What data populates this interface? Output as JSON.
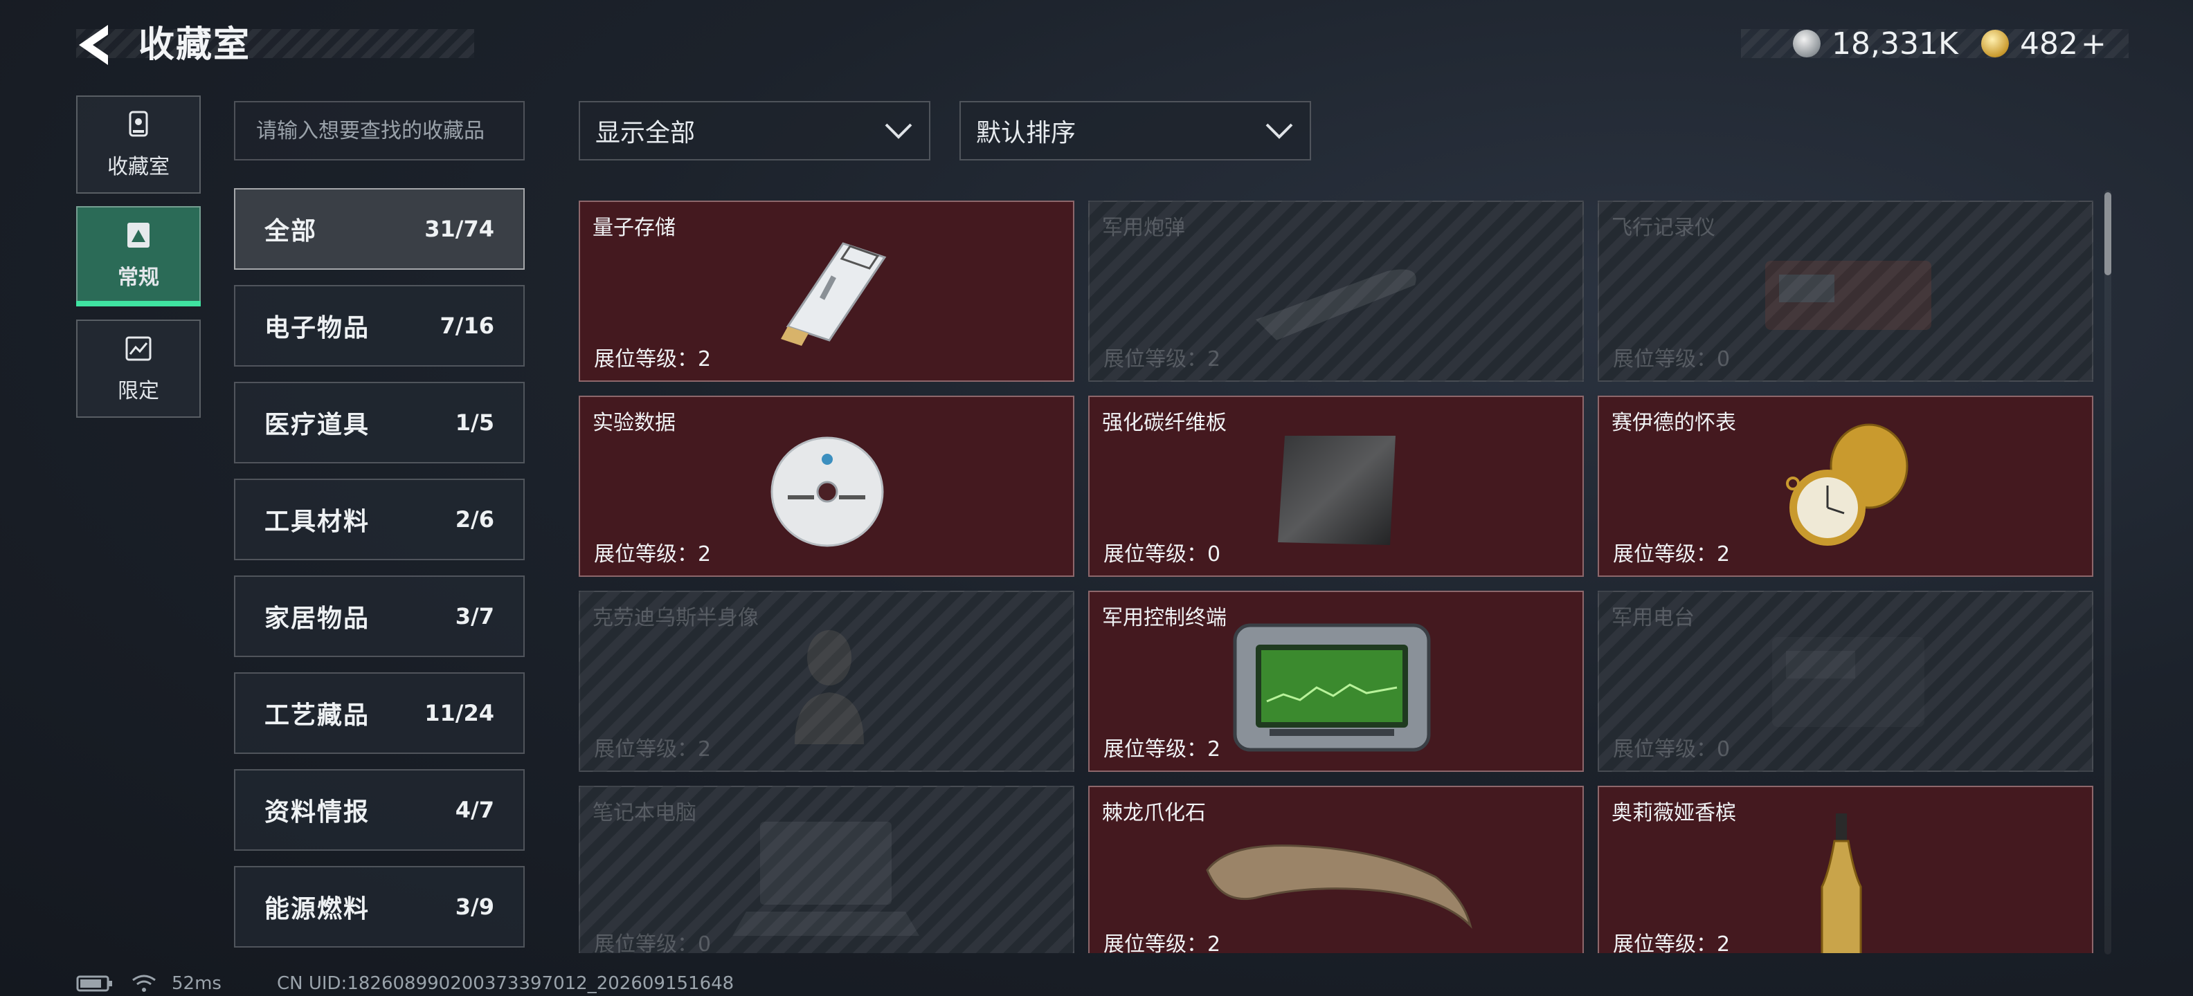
{
  "header": {
    "title": "收藏室"
  },
  "currency": {
    "silver": "18,331K",
    "gold": "482",
    "gold_suffix": "+"
  },
  "rail": [
    {
      "label": "收藏室",
      "icon": "trophy-icon",
      "active": false
    },
    {
      "label": "常规",
      "icon": "photo-icon",
      "active": true
    },
    {
      "label": "限定",
      "icon": "special-photo-icon",
      "active": false
    }
  ],
  "search": {
    "placeholder": "请输入想要查找的收藏品"
  },
  "categories": [
    {
      "label": "全部",
      "count": "31/74",
      "active": true
    },
    {
      "label": "电子物品",
      "count": "7/16"
    },
    {
      "label": "医疗道具",
      "count": "1/5"
    },
    {
      "label": "工具材料",
      "count": "2/6"
    },
    {
      "label": "家居物品",
      "count": "3/7"
    },
    {
      "label": "工艺藏品",
      "count": "11/24"
    },
    {
      "label": "资料情报",
      "count": "4/7"
    },
    {
      "label": "能源燃料",
      "count": "3/9"
    }
  ],
  "filters": {
    "show": "显示全部",
    "sort": "默认排序"
  },
  "level_prefix": "展位等级：",
  "items": [
    {
      "name": "量子存储",
      "level": "2",
      "owned": true,
      "art": "usb-drive"
    },
    {
      "name": "军用炮弹",
      "level": "2",
      "owned": false,
      "art": "shell"
    },
    {
      "name": "飞行记录仪",
      "level": "0",
      "owned": false,
      "art": "recorder"
    },
    {
      "name": "实验数据",
      "level": "2",
      "owned": true,
      "art": "disc"
    },
    {
      "name": "强化碳纤维板",
      "level": "0",
      "owned": true,
      "art": "carbon-plate"
    },
    {
      "name": "赛伊德的怀表",
      "level": "2",
      "owned": true,
      "art": "pocket-watch"
    },
    {
      "name": "克劳迪乌斯半身像",
      "level": "2",
      "owned": false,
      "art": "bust"
    },
    {
      "name": "军用控制终端",
      "level": "2",
      "owned": true,
      "art": "terminal"
    },
    {
      "name": "军用电台",
      "level": "0",
      "owned": false,
      "art": "radio"
    },
    {
      "name": "笔记本电脑",
      "level": "0",
      "owned": false,
      "art": "laptop"
    },
    {
      "name": "棘龙爪化石",
      "level": "2",
      "owned": true,
      "art": "claw"
    },
    {
      "name": "奥莉薇娅香槟",
      "level": "2",
      "owned": true,
      "art": "champagne"
    }
  ],
  "status": {
    "ping": "52ms",
    "uid": "CN UID:18260899020037339701​2_202609151648"
  }
}
